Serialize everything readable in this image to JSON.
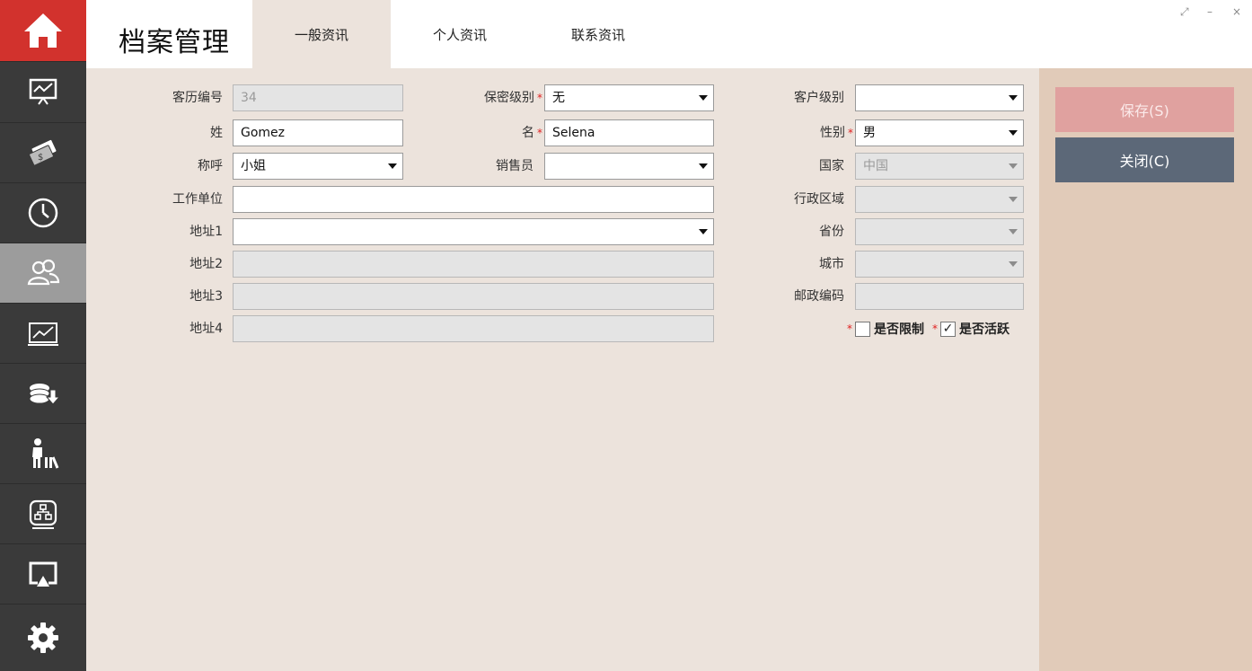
{
  "header": {
    "title": "档案管理",
    "tabs": [
      {
        "label": "一般资讯",
        "active": true
      },
      {
        "label": "个人资讯",
        "active": false
      },
      {
        "label": "联系资讯",
        "active": false
      }
    ],
    "window_controls": {
      "restore": "⤢",
      "minimize": "–",
      "close": "×"
    }
  },
  "sidebar": {
    "items": [
      {
        "icon": "home-icon"
      },
      {
        "icon": "presentation-chart-icon"
      },
      {
        "icon": "money-icon"
      },
      {
        "icon": "clock-icon"
      },
      {
        "icon": "users-icon",
        "active": true
      },
      {
        "icon": "line-chart-icon"
      },
      {
        "icon": "coins-download-icon"
      },
      {
        "icon": "traveler-icon"
      },
      {
        "icon": "network-box-icon"
      },
      {
        "icon": "airplay-icon"
      },
      {
        "icon": "gear-icon"
      }
    ]
  },
  "form": {
    "customer_id": {
      "label": "客历编号",
      "value": "34"
    },
    "security_level": {
      "label": "保密级别",
      "value": "无"
    },
    "customer_level": {
      "label": "客户级别",
      "value": ""
    },
    "last_name": {
      "label": "姓",
      "value": "Gomez"
    },
    "first_name": {
      "label": "名",
      "value": "Selena"
    },
    "gender": {
      "label": "性别",
      "value": "男"
    },
    "salutation": {
      "label": "称呼",
      "value": "小姐"
    },
    "salesperson": {
      "label": "销售员",
      "value": ""
    },
    "country": {
      "label": "国家",
      "value": "中国"
    },
    "company": {
      "label": "工作单位",
      "value": ""
    },
    "region": {
      "label": "行政区域",
      "value": ""
    },
    "address1": {
      "label": "地址1",
      "value": ""
    },
    "province": {
      "label": "省份",
      "value": ""
    },
    "address2": {
      "label": "地址2",
      "value": ""
    },
    "city": {
      "label": "城市",
      "value": ""
    },
    "address3": {
      "label": "地址3",
      "value": ""
    },
    "postal_code": {
      "label": "邮政编码",
      "value": ""
    },
    "address4": {
      "label": "地址4",
      "value": ""
    },
    "restricted": {
      "label": "是否限制",
      "checked": false
    },
    "active": {
      "label": "是否活跃",
      "checked": true,
      "mark": "✓"
    },
    "required_mark": "*"
  },
  "actions": {
    "save_label": "保存(S)",
    "close_label": "关闭(C)"
  },
  "colors": {
    "accent_red": "#d2322d",
    "sidebar_bg": "#3a3a3a",
    "content_bg": "#ece3dc",
    "right_panel_bg": "#e1cbb9",
    "save_button": "#e0a19f",
    "close_button": "#5c6878"
  }
}
